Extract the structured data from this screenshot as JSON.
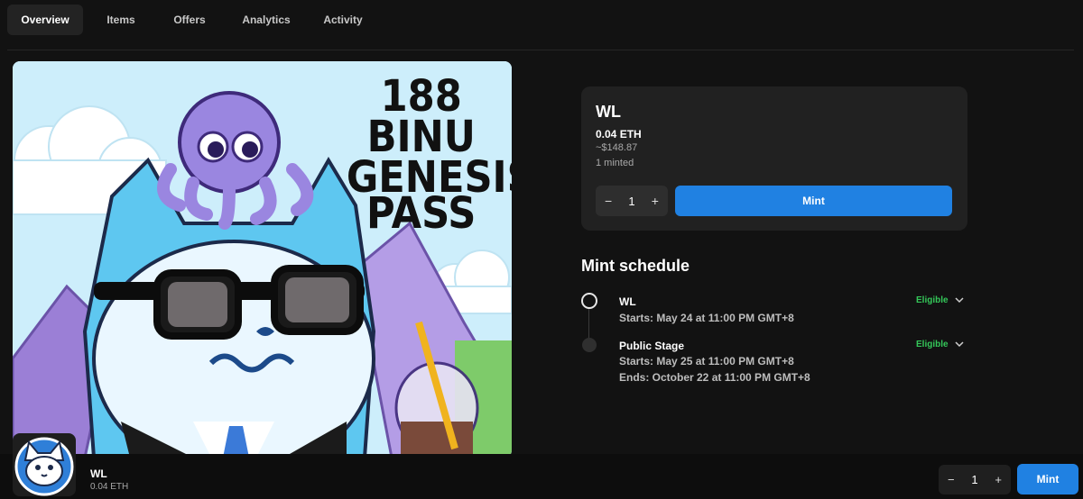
{
  "tabs": [
    {
      "label": "Overview",
      "active": true
    },
    {
      "label": "Items",
      "active": false
    },
    {
      "label": "Offers",
      "active": false
    },
    {
      "label": "Analytics",
      "active": false
    },
    {
      "label": "Activity",
      "active": false
    }
  ],
  "artwork": {
    "lines": [
      "188",
      "BINU",
      "GENESIS",
      "PASS"
    ]
  },
  "mint_card": {
    "title": "WL",
    "price": "0.04 ETH",
    "usd": "~$148.87",
    "minted": "1 minted",
    "quantity": "1",
    "minus": "−",
    "plus": "+",
    "mint_label": "Mint"
  },
  "schedule": {
    "title": "Mint schedule",
    "stages": [
      {
        "name": "WL",
        "status": "Eligible",
        "lines": [
          "Starts: May 24 at 11:00 PM GMT+8"
        ]
      },
      {
        "name": "Public Stage",
        "status": "Eligible",
        "lines": [
          "Starts: May 25 at 11:00 PM GMT+8",
          "Ends: October 22 at 11:00 PM GMT+8"
        ]
      }
    ]
  },
  "bottom_bar": {
    "title": "WL",
    "price": "0.04 ETH",
    "quantity": "1",
    "minus": "−",
    "plus": "+",
    "mint_label": "Mint"
  },
  "colors": {
    "accent": "#2081e2",
    "eligible": "#34c759",
    "background": "#121212",
    "card": "#212121"
  }
}
